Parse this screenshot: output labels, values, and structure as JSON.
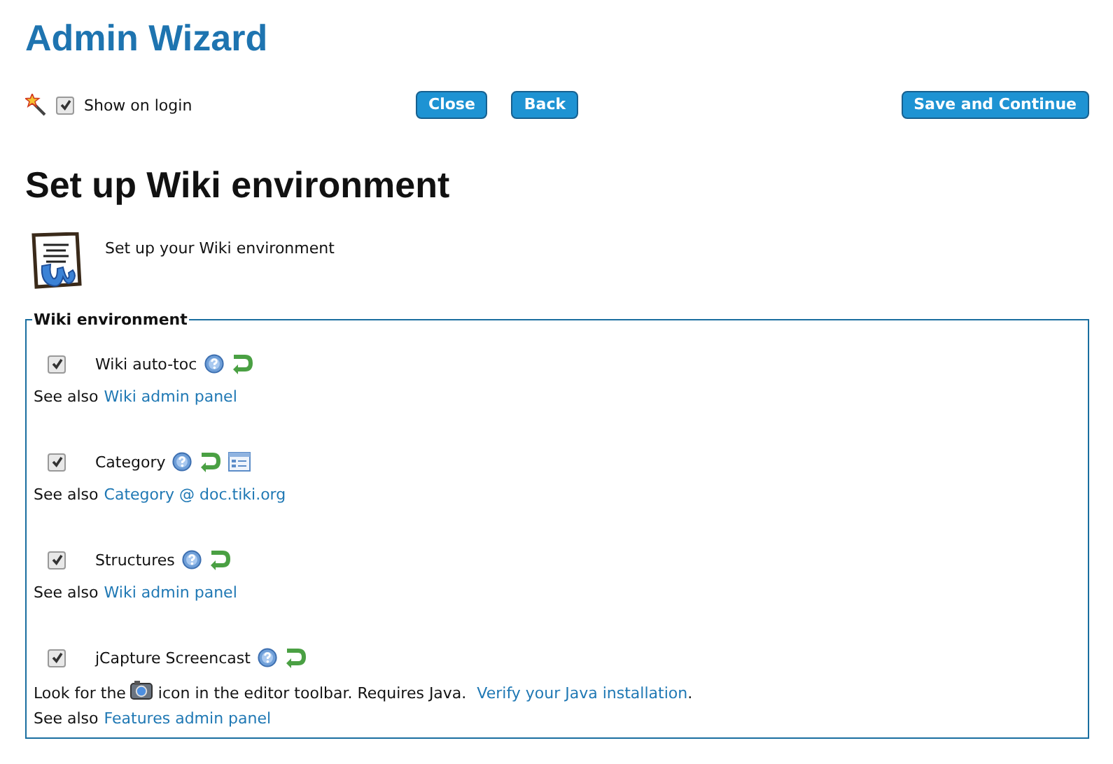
{
  "title": "Admin Wizard",
  "toolbar": {
    "show_on_login": {
      "label": "Show on login",
      "checked": true
    },
    "buttons": [
      {
        "label": "Close",
        "kind": "nav"
      },
      {
        "label": "Back",
        "kind": "nav"
      },
      {
        "label": "Save and Continue",
        "kind": "primary"
      }
    ]
  },
  "heading": "Set up Wiki environment",
  "intro": "Set up your Wiki environment",
  "section": {
    "legend": "Wiki environment",
    "features": [
      {
        "label": "Wiki auto-toc",
        "checked": true,
        "icons": [
          {
            "kind": "help"
          },
          {
            "kind": "apply"
          }
        ],
        "see_also": "See also",
        "link": "Wiki admin panel"
      },
      {
        "label": "Category",
        "checked": true,
        "icons": [
          {
            "kind": "help"
          },
          {
            "kind": "apply"
          },
          {
            "kind": "config"
          }
        ],
        "see_also": "See also",
        "link": "Category @ doc.tiki.org"
      },
      {
        "label": "Structures",
        "checked": true,
        "icons": [
          {
            "kind": "help"
          },
          {
            "kind": "apply"
          }
        ],
        "see_also": "See also",
        "link": "Wiki admin panel"
      },
      {
        "label": "jCapture Screencast",
        "checked": true,
        "icons": [
          {
            "kind": "help"
          },
          {
            "kind": "apply"
          }
        ],
        "note": {
          "before": "Look for the",
          "after": "icon in the editor toolbar. Requires Java.",
          "link": "Verify your Java installation",
          "end": "."
        },
        "see_also": "See also",
        "link": "Features admin panel"
      }
    ]
  }
}
